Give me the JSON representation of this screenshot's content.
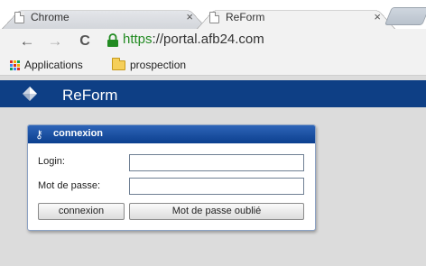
{
  "browser": {
    "tabs": [
      {
        "title": "Chrome",
        "close": "×"
      },
      {
        "title": "ReForm",
        "close": "×"
      }
    ],
    "nav": {
      "back": "←",
      "forward": "→",
      "reload": "C"
    },
    "address": {
      "scheme": "https",
      "rest": "://portal.afb24.com"
    },
    "bookmarks": [
      {
        "label": "Applications",
        "icon": "apps-grid-icon"
      },
      {
        "label": "prospection",
        "icon": "folder-icon"
      }
    ]
  },
  "app": {
    "name": "ReForm"
  },
  "login": {
    "title": "connexion",
    "login_label": "Login:",
    "login_value": "",
    "password_label": "Mot de passe:",
    "password_value": "",
    "submit_label": "connexion",
    "forgot_label": "Mot de passe oublié"
  },
  "colors": {
    "header": "#0e3f85",
    "panel_header": "#1f56a8",
    "secure": "#228b22"
  }
}
